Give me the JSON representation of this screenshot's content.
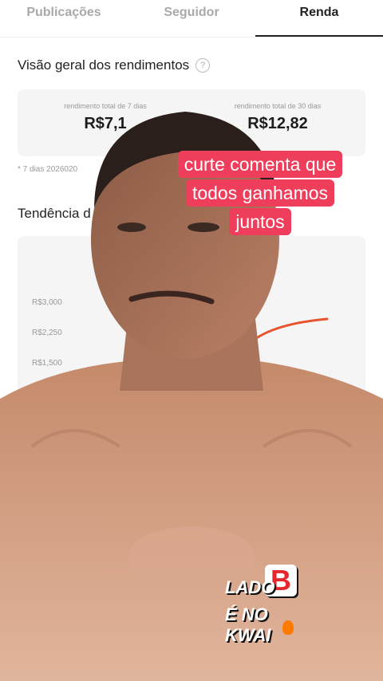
{
  "tabs": [
    "Publicações",
    "Seguidor",
    "Renda"
  ],
  "active_tab": "Renda",
  "overview": {
    "title": "Visão geral dos rendimentos",
    "stats": [
      {
        "label": "rendimento total de 7 dias",
        "value": "R$7,1"
      },
      {
        "label": "rendimento total de 30 dias",
        "value": "R$12,82"
      }
    ],
    "date_note": "* 7 dias 2026020"
  },
  "trend": {
    "title": "Tendência d",
    "ticks": [
      "R$3,000",
      "R$2,250",
      "R$1,500"
    ]
  },
  "caption": [
    "curte comenta que",
    "todos ganhamos",
    "juntos"
  ],
  "sticker": {
    "line1": "LADO",
    "line2": "É NO KWAI",
    "badge": "B"
  },
  "colors": {
    "caption_bg": "#ef3e5c",
    "trend_line": "#e8532f"
  }
}
